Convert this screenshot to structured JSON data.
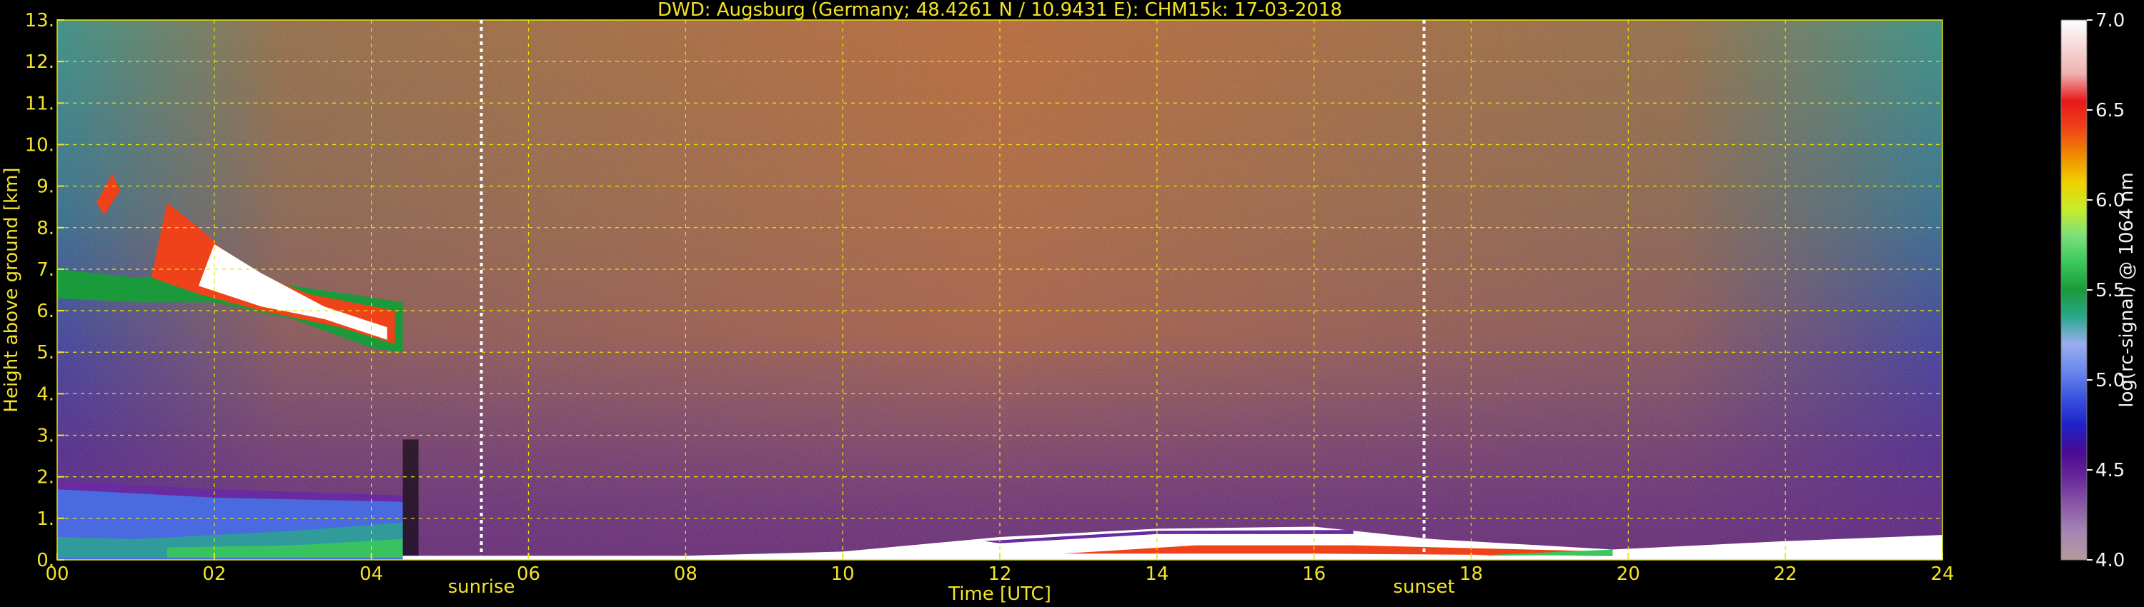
{
  "chart_data": {
    "type": "heatmap",
    "title": "DWD: Augsburg (Germany; 48.4261 N / 10.9431 E):    CHM15k: 17-03-2018",
    "xlabel": "Time [UTC]",
    "ylabel": "Height above ground [km]",
    "colorbar_label": "log(rc-signal) @ 1064 nm",
    "xlim": [
      0,
      24
    ],
    "ylim": [
      0,
      13
    ],
    "x_ticks": [
      0,
      2,
      4,
      6,
      8,
      10,
      12,
      14,
      16,
      18,
      20,
      22,
      24
    ],
    "x_tick_labels": [
      "00",
      "02",
      "04",
      "06",
      "08",
      "10",
      "12",
      "14",
      "16",
      "18",
      "20",
      "22",
      "24"
    ],
    "y_ticks": [
      0,
      1,
      2,
      3,
      4,
      5,
      6,
      7,
      8,
      9,
      10,
      11,
      12,
      13
    ],
    "y_tick_labels": [
      "0.",
      "1.",
      "2.",
      "3.",
      "4.",
      "5.",
      "6.",
      "7.",
      "8.",
      "9.",
      "10.",
      "11.",
      "12.",
      "13."
    ],
    "colorbar_range": [
      4.0,
      7.0
    ],
    "colorbar_ticks": [
      4.0,
      4.5,
      5.0,
      5.5,
      6.0,
      6.5,
      7.0
    ],
    "colorbar_tick_labels": [
      "4.0",
      "4.5",
      "5.0",
      "5.5",
      "6.0",
      "6.5",
      "7.0"
    ],
    "grid": true,
    "grid_color": "#e6e600",
    "colormap": [
      "#b79a9c",
      "#a787b3",
      "#8a5aa8",
      "#6a2a9a",
      "#4a0a92",
      "#1e22c8",
      "#3a52e0",
      "#6a88ec",
      "#9aaef0",
      "#2aa88a",
      "#1a9a3a",
      "#3ac85a",
      "#7ae07a",
      "#c8ec2a",
      "#f0d000",
      "#f08a00",
      "#f0421a",
      "#e81818",
      "#f0b0b0",
      "#f6d8d8",
      "#ffffff"
    ],
    "annotations": [
      {
        "text": "sunrise",
        "x": 5.4
      },
      {
        "text": "sunset",
        "x": 17.4
      }
    ]
  }
}
